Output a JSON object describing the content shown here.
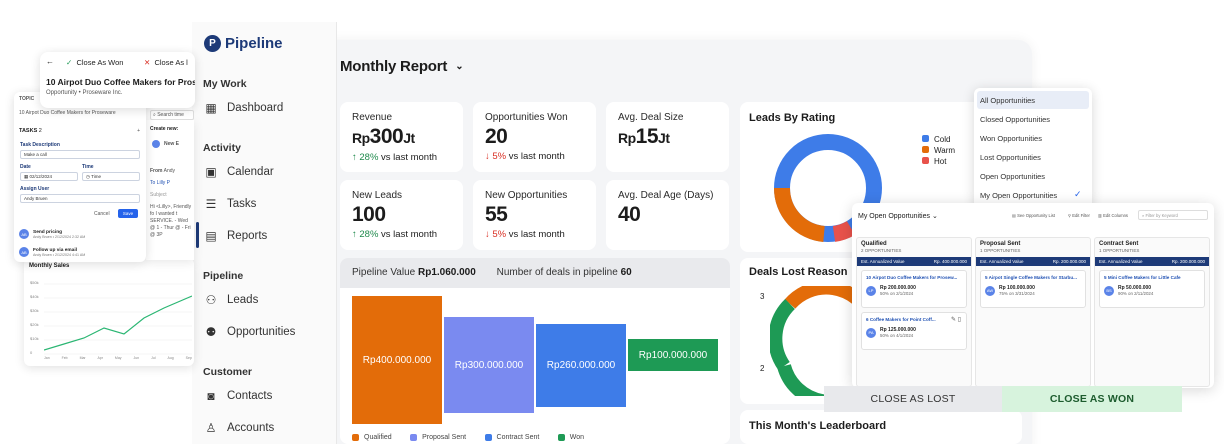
{
  "report": {
    "title": "Monthly Report"
  },
  "kpis": [
    {
      "label": "Revenue",
      "value_prefix": "Rp",
      "value": "300",
      "value_suffix": "Jt",
      "delta_arrow": "↑",
      "delta": "28%",
      "delta_text": "vs last month",
      "trend": "up"
    },
    {
      "label": "Opportunities Won",
      "value": "20",
      "delta_arrow": "↓",
      "delta": "5%",
      "delta_text": "vs last month",
      "trend": "down"
    },
    {
      "label": "Avg. Deal Size",
      "value_prefix": "Rp",
      "value": "15",
      "value_suffix": "Jt"
    },
    {
      "label": "New Leads",
      "value": "100",
      "delta_arrow": "↑",
      "delta": "28%",
      "delta_text": "vs last month",
      "trend": "up"
    },
    {
      "label": "New Opportunities",
      "value": "55",
      "delta_arrow": "↓",
      "delta": "5%",
      "delta_text": "vs last month",
      "trend": "down"
    },
    {
      "label": "Avg. Deal Age (Days)",
      "value": "40"
    }
  ],
  "pipeline": {
    "value_label": "Pipeline Value",
    "value": "Rp1.060.000",
    "deals_label": "Number of deals in pipeline",
    "deals": "60",
    "bars": [
      {
        "label": "Rp400.000.000",
        "value": 400000000,
        "color": "#e36c09"
      },
      {
        "label": "Rp300.000.000",
        "value": 300000000,
        "color": "#7a8af0"
      },
      {
        "label": "Rp260.000.000",
        "value": 260000000,
        "color": "#3e7ce8"
      },
      {
        "label": "Rp100.000.000",
        "value": 100000000,
        "color": "#1e9a55"
      }
    ],
    "legend": [
      {
        "label": "Qualified",
        "color": "#e36c09"
      },
      {
        "label": "Proposal Sent",
        "color": "#7a8af0"
      },
      {
        "label": "Contract Sent",
        "color": "#3e7ce8"
      },
      {
        "label": "Won",
        "color": "#1e9a55"
      }
    ]
  },
  "rating": {
    "title": "Leads By Rating",
    "legend": [
      {
        "label": "Cold",
        "color": "#3e7ce8"
      },
      {
        "label": "Warm",
        "color": "#e36c09"
      },
      {
        "label": "Hot",
        "color": "#e8524b"
      }
    ]
  },
  "lost": {
    "title": "Deals Lost Reason",
    "tick_3": "3",
    "tick_2": "2"
  },
  "leaderboard": {
    "title": "This Month's Leaderboard"
  },
  "sidebar": {
    "brand": "Pipeline",
    "sections": {
      "work": "My Work",
      "activity": "Activity",
      "pipeline": "Pipeline",
      "customer": "Customer"
    },
    "items": {
      "dashboard": "Dashboard",
      "calendar": "Calendar",
      "tasks": "Tasks",
      "reports": "Reports",
      "leads": "Leads",
      "opportunities": "Opportunities",
      "contacts": "Contacts",
      "accounts": "Accounts"
    }
  },
  "opp_card": {
    "close_won": "Close As Won",
    "close_lost": "Close As l",
    "title": "10 Airpot Duo Coffee Makers for Prose",
    "subtitle": "Opportunity • Proseware Inc."
  },
  "task_card": {
    "topic_label": "TOPIC",
    "topic_value": "10 Airpot Duo Coffee Makers for Proseware",
    "tasks_label": "TASKS",
    "tasks_count": "2",
    "desc_label": "Task Description",
    "desc_value": "Make a call",
    "date_label": "Date",
    "date_value": "02/12/2024",
    "time_label": "Time",
    "time_value": "Time",
    "assign_label": "Assign User",
    "assign_value": "Andy Bruen",
    "cancel": "Cancel",
    "save": "Save",
    "items": [
      {
        "initials": "AB",
        "title": "Send pricing",
        "sub": "Andy Bruen • 2/12/2024 2:32 AM"
      },
      {
        "initials": "AB",
        "title": "Follow up via email",
        "sub": "Andy Bruen • 2/12/2024 4:41 AM"
      }
    ]
  },
  "mail_card": {
    "search": "Search time",
    "create": "Create new:",
    "from": "From",
    "from_v": "Andy",
    "to": "To",
    "to_v": "Lilly P",
    "subject": "Subject",
    "new": "New E",
    "body": "Hi <Lilly>, Friendly fo I wanted t SERVICE. - Wed @ 1 - Thur @ - Fri @ 3P"
  },
  "sales_card": {
    "title": "Monthly Sales",
    "yticks": [
      "$50k",
      "$40k",
      "$30k",
      "$20k",
      "$10k",
      "0"
    ],
    "xticks": [
      "Jan",
      "Feb",
      "Mar",
      "Apr",
      "May",
      "Jun",
      "Jul",
      "Aug",
      "Sep"
    ]
  },
  "dropdown": {
    "options": [
      "All Opportunities",
      "Closed Opportunities",
      "Won Opportunities",
      "Lost Opportunities",
      "Open Opportunities",
      "My Open Opportunities"
    ],
    "selected_highlight": "All Opportunities",
    "checked": "My Open Opportunities"
  },
  "myopp": {
    "title": "My Open Opportunities",
    "toolbar": {
      "see": "See Opportunity List",
      "edit_filter": "Edit Filter",
      "edit_columns": "Edit Columns",
      "filter_placeholder": "Filter by Keyword"
    },
    "columns": [
      {
        "name": "Qualified",
        "count": "2 OPPORTUNITIES",
        "est_label": "Est. Annualized Value",
        "est": "Rp. 400.000.000",
        "cards": [
          {
            "title": "10 Airpot Duo Coffee Makers for Prosew...",
            "initials": "LP",
            "amount": "Rp 200.000.000",
            "date": "50% on 2/1/2024"
          },
          {
            "title": "6 Coffee Makers for Point Coff...",
            "initials": "PA",
            "amount": "Rp 125.000.000",
            "date": "50% on 4/1/2024"
          }
        ]
      },
      {
        "name": "Proposal Sent",
        "count": "1 OPPORTUNITIES",
        "est_label": "Est. Annualized Value",
        "est": "Rp. 200.000.000",
        "cards": [
          {
            "title": "5 Airpot Single Coffee Makers for Starbu...",
            "initials": "AW",
            "amount": "Rp 100.000.000",
            "date": "75% on 3/31/2024"
          }
        ]
      },
      {
        "name": "Contract Sent",
        "count": "1 OPPORTUNITIES",
        "est_label": "Est. Annualized Value",
        "est": "Rp. 200.000.000",
        "cards": [
          {
            "title": "5 Mini Coffee Makers for Little Cafe",
            "initials": "BS",
            "amount": "Rp 50.000.000",
            "date": "90% on 2/11/2024"
          }
        ]
      }
    ]
  },
  "actions": {
    "close_lost": "CLOSE AS LOST",
    "close_won": "CLOSE AS WON"
  }
}
